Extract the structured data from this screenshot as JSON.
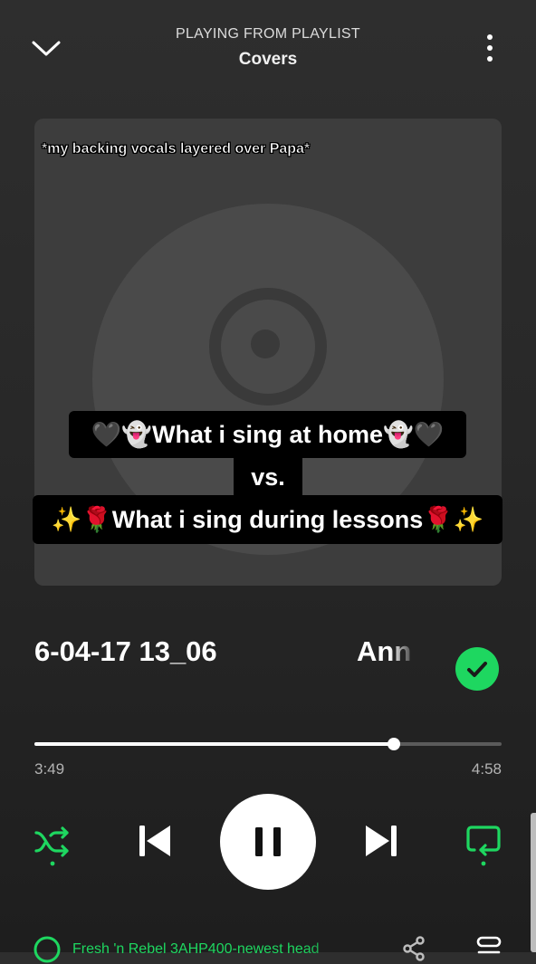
{
  "header": {
    "context_label": "PLAYING FROM PLAYLIST",
    "playlist_name": "Covers",
    "collapse_icon": "chevron-down-icon",
    "more_icon": "more-vertical-icon"
  },
  "overlay": {
    "top_caption": "*my backing vocals layered over Papa*",
    "line1": "🖤👻What i sing at home👻🖤",
    "line2": "vs.",
    "line3": "✨🌹What i sing during lessons🌹✨"
  },
  "track": {
    "title": "6-04-17 13_06",
    "artist": "Ann",
    "saved": true
  },
  "playback": {
    "elapsed": "3:49",
    "total": "4:58",
    "progress_fraction": 0.769,
    "state": "playing"
  },
  "device": {
    "label": "Fresh 'n Rebel 3AHP400-newest head"
  },
  "colors": {
    "accent": "#1ed760",
    "background": "#282828"
  }
}
